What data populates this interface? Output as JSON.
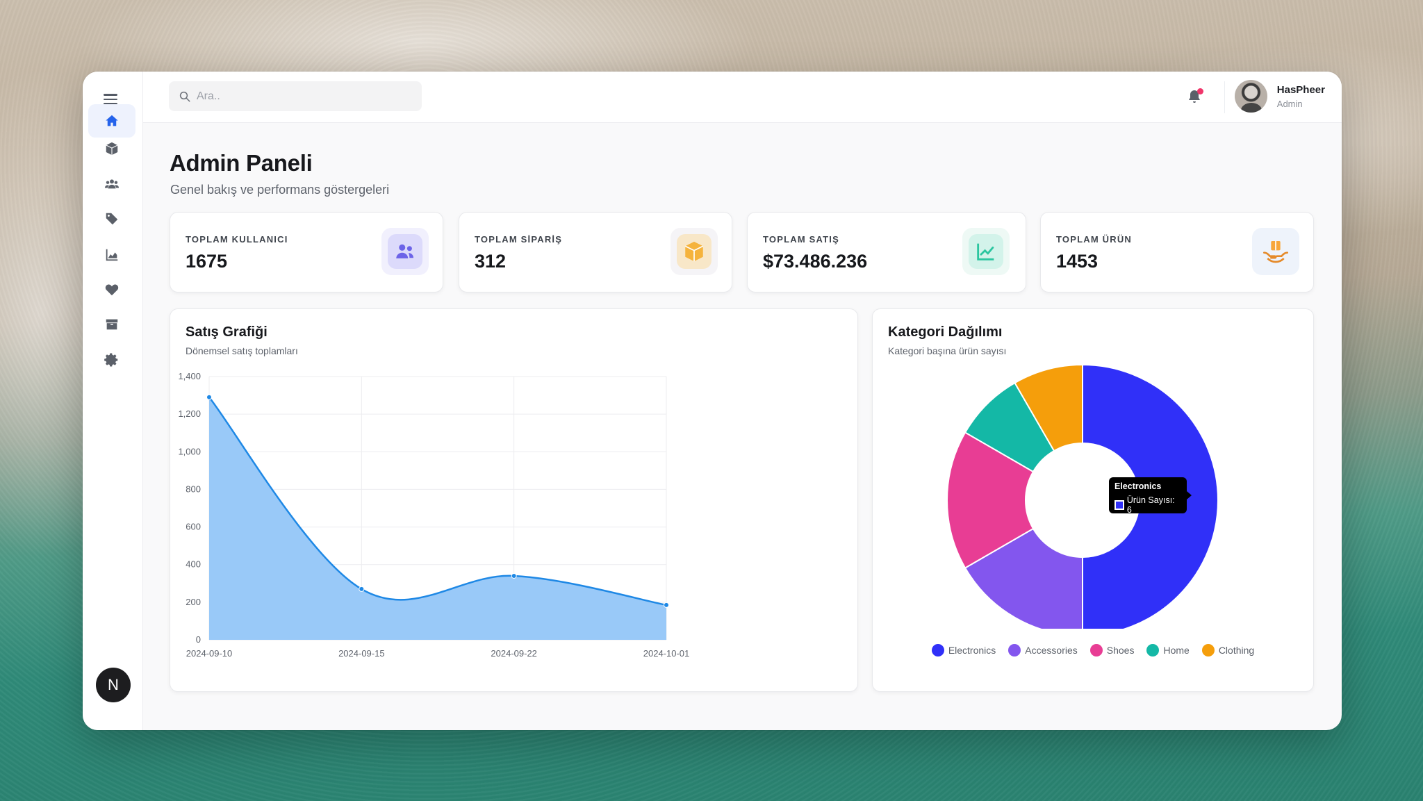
{
  "search": {
    "placeholder": "Ara.."
  },
  "user": {
    "name": "HasPheer",
    "role": "Admin"
  },
  "sidebar": {
    "items": [
      {
        "name": "home"
      },
      {
        "name": "products"
      },
      {
        "name": "users"
      },
      {
        "name": "tags"
      },
      {
        "name": "analytics"
      },
      {
        "name": "favorites"
      },
      {
        "name": "inventory"
      },
      {
        "name": "settings"
      }
    ],
    "avatar_letter": "N"
  },
  "page": {
    "title": "Admin Paneli",
    "subtitle": "Genel bakış ve performans göstergeleri"
  },
  "stats": [
    {
      "label": "TOPLAM KULLANICI",
      "value": "1675",
      "color": "#6c63e8"
    },
    {
      "label": "TOPLAM SİPARİŞ",
      "value": "312",
      "color": "#f5b33c"
    },
    {
      "label": "TOPLAM SATIŞ",
      "value": "$73.486.236",
      "color": "#2cc6a0"
    },
    {
      "label": "TOPLAM ÜRÜN",
      "value": "1453",
      "color": "#f7a63b"
    }
  ],
  "sales": {
    "title": "Satış Grafiği",
    "subtitle": "Dönemsel satış toplamları"
  },
  "category": {
    "title": "Kategori Dağılımı",
    "subtitle": "Kategori başına ürün sayısı",
    "tooltip": {
      "title": "Electronics",
      "row": "Ürün Sayısı: 6"
    }
  },
  "chart_data": [
    {
      "type": "area",
      "x": [
        "2024-09-10",
        "2024-09-15",
        "2024-09-22",
        "2024-10-01"
      ],
      "values": [
        1290,
        270,
        340,
        185
      ],
      "ylim": [
        0,
        1400
      ],
      "yticks": [
        "0",
        "200",
        "400",
        "600",
        "800",
        "1,000",
        "1,200",
        "1,400"
      ],
      "grid": true,
      "fill_color": "#99c9f8",
      "line_color": "#1e88e5"
    },
    {
      "type": "pie",
      "categories": [
        "Electronics",
        "Accessories",
        "Shoes",
        "Home",
        "Clothing"
      ],
      "values": [
        6,
        2,
        2,
        1,
        1
      ],
      "colors": [
        "#3030f8",
        "#8356ee",
        "#e83d94",
        "#14b8a6",
        "#f59e0b"
      ],
      "legend": "bottom"
    }
  ]
}
